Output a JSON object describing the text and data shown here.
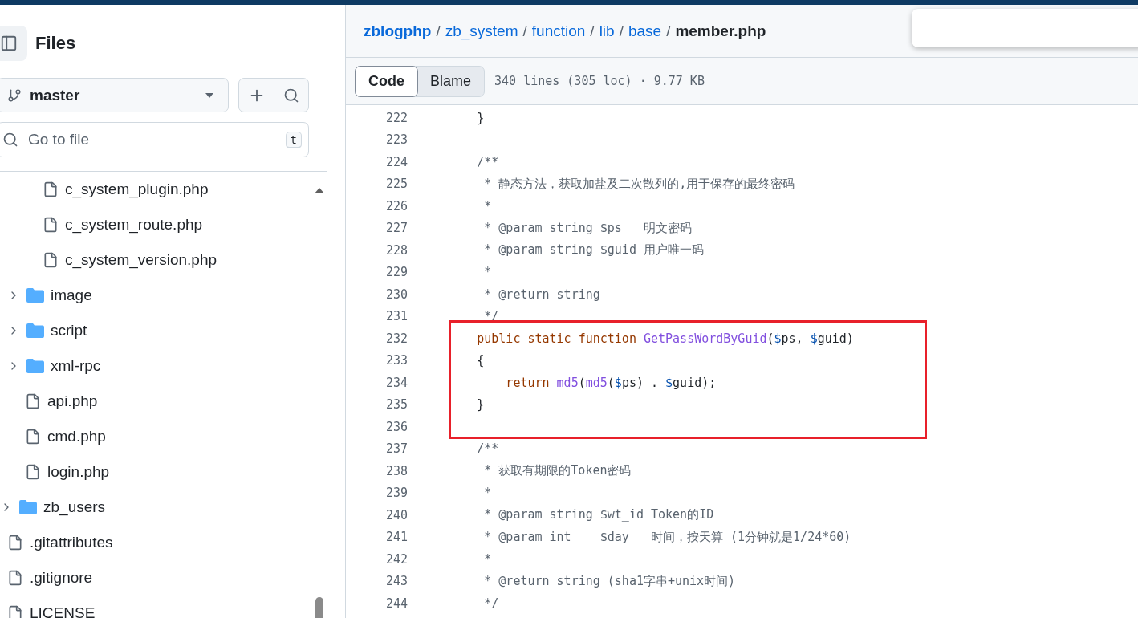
{
  "sidebar": {
    "title": "Files",
    "branch": "master",
    "search": {
      "placeholder": "Go to file",
      "shortcut": "t"
    },
    "tree": [
      {
        "children": [
          {
            "children": [
              {
                "name": "c_system_plugin.php",
                "kind": "file"
              },
              {
                "name": "c_system_route.php",
                "kind": "file"
              },
              {
                "name": "c_system_version.php",
                "kind": "file"
              }
            ]
          },
          {
            "name": "image",
            "kind": "folder",
            "expanded": false
          },
          {
            "name": "script",
            "kind": "folder",
            "expanded": false
          },
          {
            "name": "xml-rpc",
            "kind": "folder",
            "expanded": false
          },
          {
            "name": "api.php",
            "kind": "file"
          },
          {
            "name": "cmd.php",
            "kind": "file"
          },
          {
            "name": "login.php",
            "kind": "file"
          }
        ]
      },
      {
        "name": "zb_users",
        "kind": "folder",
        "expanded": false
      },
      {
        "name": ".gitattributes",
        "kind": "file"
      },
      {
        "name": ".gitignore",
        "kind": "file"
      },
      {
        "name": "LICENSE",
        "kind": "file"
      }
    ]
  },
  "breadcrumb": {
    "links": [
      "zblogphp",
      "zb_system",
      "function",
      "lib",
      "base"
    ],
    "separator": "/",
    "current": "member.php"
  },
  "tabs": [
    {
      "label": "Code",
      "selected": true
    },
    {
      "label": "Blame",
      "selected": false
    }
  ],
  "file_info": "340 lines (305 loc) · 9.77 KB",
  "code": [
    {
      "number": "222",
      "tokens": [
        {
          "kind": "plain",
          "text": "        }"
        }
      ]
    },
    {
      "number": "223"
    },
    {
      "number": "224",
      "tokens": [
        {
          "kind": "comment",
          "text": "        /**"
        }
      ]
    },
    {
      "number": "225",
      "tokens": [
        {
          "kind": "comment",
          "text": "         * 静态方法，获取加盐及二次散列的,用于保存的最终密码"
        }
      ]
    },
    {
      "number": "226",
      "tokens": [
        {
          "kind": "comment",
          "text": "         *"
        }
      ]
    },
    {
      "number": "227",
      "tokens": [
        {
          "kind": "comment",
          "text": "         * @param string $ps   明文密码"
        }
      ]
    },
    {
      "number": "228",
      "tokens": [
        {
          "kind": "comment",
          "text": "         * @param string $guid 用户唯一码"
        }
      ]
    },
    {
      "number": "229",
      "tokens": [
        {
          "kind": "comment",
          "text": "         *"
        }
      ]
    },
    {
      "number": "230",
      "tokens": [
        {
          "kind": "comment",
          "text": "         * @return string"
        }
      ]
    },
    {
      "number": "231",
      "tokens": [
        {
          "kind": "comment",
          "text": "         */"
        }
      ]
    },
    {
      "number": "232",
      "tokens": [
        {
          "kind": "keyword",
          "text": "        public "
        },
        {
          "kind": "keyword",
          "text": "static "
        },
        {
          "kind": "keyword",
          "text": "function "
        },
        {
          "kind": "entity",
          "text": "GetPassWordByGuid"
        },
        {
          "kind": "plain",
          "text": "("
        },
        {
          "kind": "sigil",
          "text": "$"
        },
        {
          "kind": "plain",
          "text": "ps, "
        },
        {
          "kind": "sigil",
          "text": "$"
        },
        {
          "kind": "plain",
          "text": "guid)"
        }
      ]
    },
    {
      "number": "233",
      "tokens": [
        {
          "kind": "plain",
          "text": "        {"
        }
      ]
    },
    {
      "number": "234",
      "tokens": [
        {
          "kind": "keyword",
          "text": "            return "
        },
        {
          "kind": "entity",
          "text": "md5"
        },
        {
          "kind": "plain",
          "text": "("
        },
        {
          "kind": "entity",
          "text": "md5"
        },
        {
          "kind": "plain",
          "text": "("
        },
        {
          "kind": "sigil",
          "text": "$"
        },
        {
          "kind": "plain",
          "text": "ps) . "
        },
        {
          "kind": "sigil",
          "text": "$"
        },
        {
          "kind": "plain",
          "text": "guid);"
        }
      ]
    },
    {
      "number": "235",
      "tokens": [
        {
          "kind": "plain",
          "text": "        }"
        }
      ]
    },
    {
      "number": "236"
    },
    {
      "number": "237",
      "tokens": [
        {
          "kind": "comment",
          "text": "        /**"
        }
      ]
    },
    {
      "number": "238",
      "tokens": [
        {
          "kind": "comment",
          "text": "         * 获取有期限的Token密码"
        }
      ]
    },
    {
      "number": "239",
      "tokens": [
        {
          "kind": "comment",
          "text": "         *"
        }
      ]
    },
    {
      "number": "240",
      "tokens": [
        {
          "kind": "comment",
          "text": "         * @param string $wt_id Token的ID"
        }
      ]
    },
    {
      "number": "241",
      "tokens": [
        {
          "kind": "comment",
          "text": "         * @param int    $day   时间，按天算 (1分钟就是1/24*60)"
        }
      ]
    },
    {
      "number": "242",
      "tokens": [
        {
          "kind": "comment",
          "text": "         *"
        }
      ]
    },
    {
      "number": "243",
      "tokens": [
        {
          "kind": "comment",
          "text": "         * @return string (sha1字串+unix时间)"
        }
      ]
    },
    {
      "number": "244",
      "tokens": [
        {
          "kind": "comment",
          "text": "         */"
        }
      ]
    }
  ]
}
